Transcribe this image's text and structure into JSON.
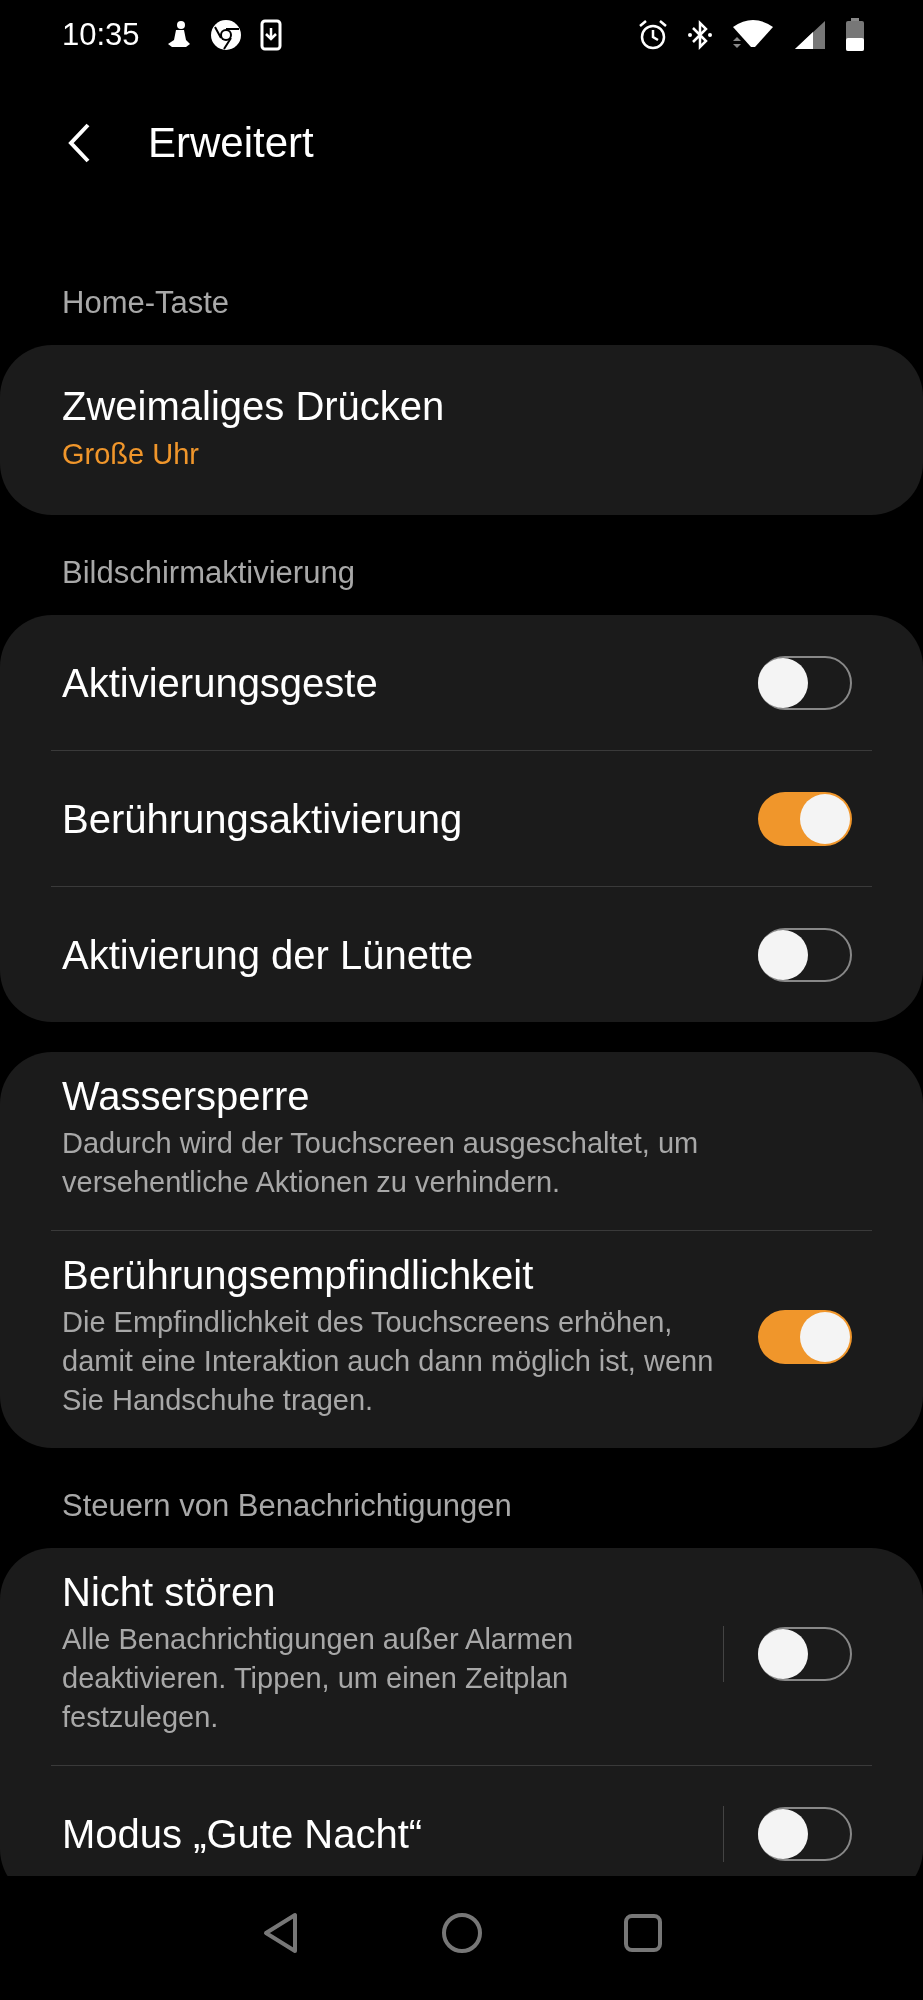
{
  "status_bar": {
    "time": "10:35"
  },
  "header": {
    "title": "Erweitert"
  },
  "sections": [
    {
      "label": "Home-Taste",
      "items": [
        {
          "kind": "value",
          "title": "Zweimaliges Drücken",
          "value": "Große Uhr"
        }
      ]
    },
    {
      "label": "Bildschirmaktivierung",
      "items": [
        {
          "kind": "toggle",
          "title": "Aktivierungsgeste",
          "on": false
        },
        {
          "kind": "toggle",
          "title": "Berührungsaktivierung",
          "on": true
        },
        {
          "kind": "toggle",
          "title": "Aktivierung der Lünette",
          "on": false
        }
      ]
    },
    {
      "items": [
        {
          "kind": "text",
          "title": "Wassersperre",
          "description": "Dadurch wird der Touchscreen ausgeschaltet, um versehentliche Aktionen zu verhindern."
        },
        {
          "kind": "toggle",
          "title": "Berührungsempfindlichkeit",
          "description": "Die Empfindlichkeit des Touchscreens erhöhen, damit eine Interaktion auch dann möglich ist, wenn Sie Handschuhe tragen.",
          "on": true
        }
      ]
    },
    {
      "label": "Steuern von Benachrichtigungen",
      "items": [
        {
          "kind": "split-toggle",
          "title": "Nicht stören",
          "description": "Alle Benachrichtigungen außer Alarmen deaktivieren. Tippen, um einen Zeitplan festzulegen.",
          "on": false
        },
        {
          "kind": "split-toggle",
          "title": "Modus „Gute Nacht“",
          "on": false
        }
      ]
    }
  ]
}
